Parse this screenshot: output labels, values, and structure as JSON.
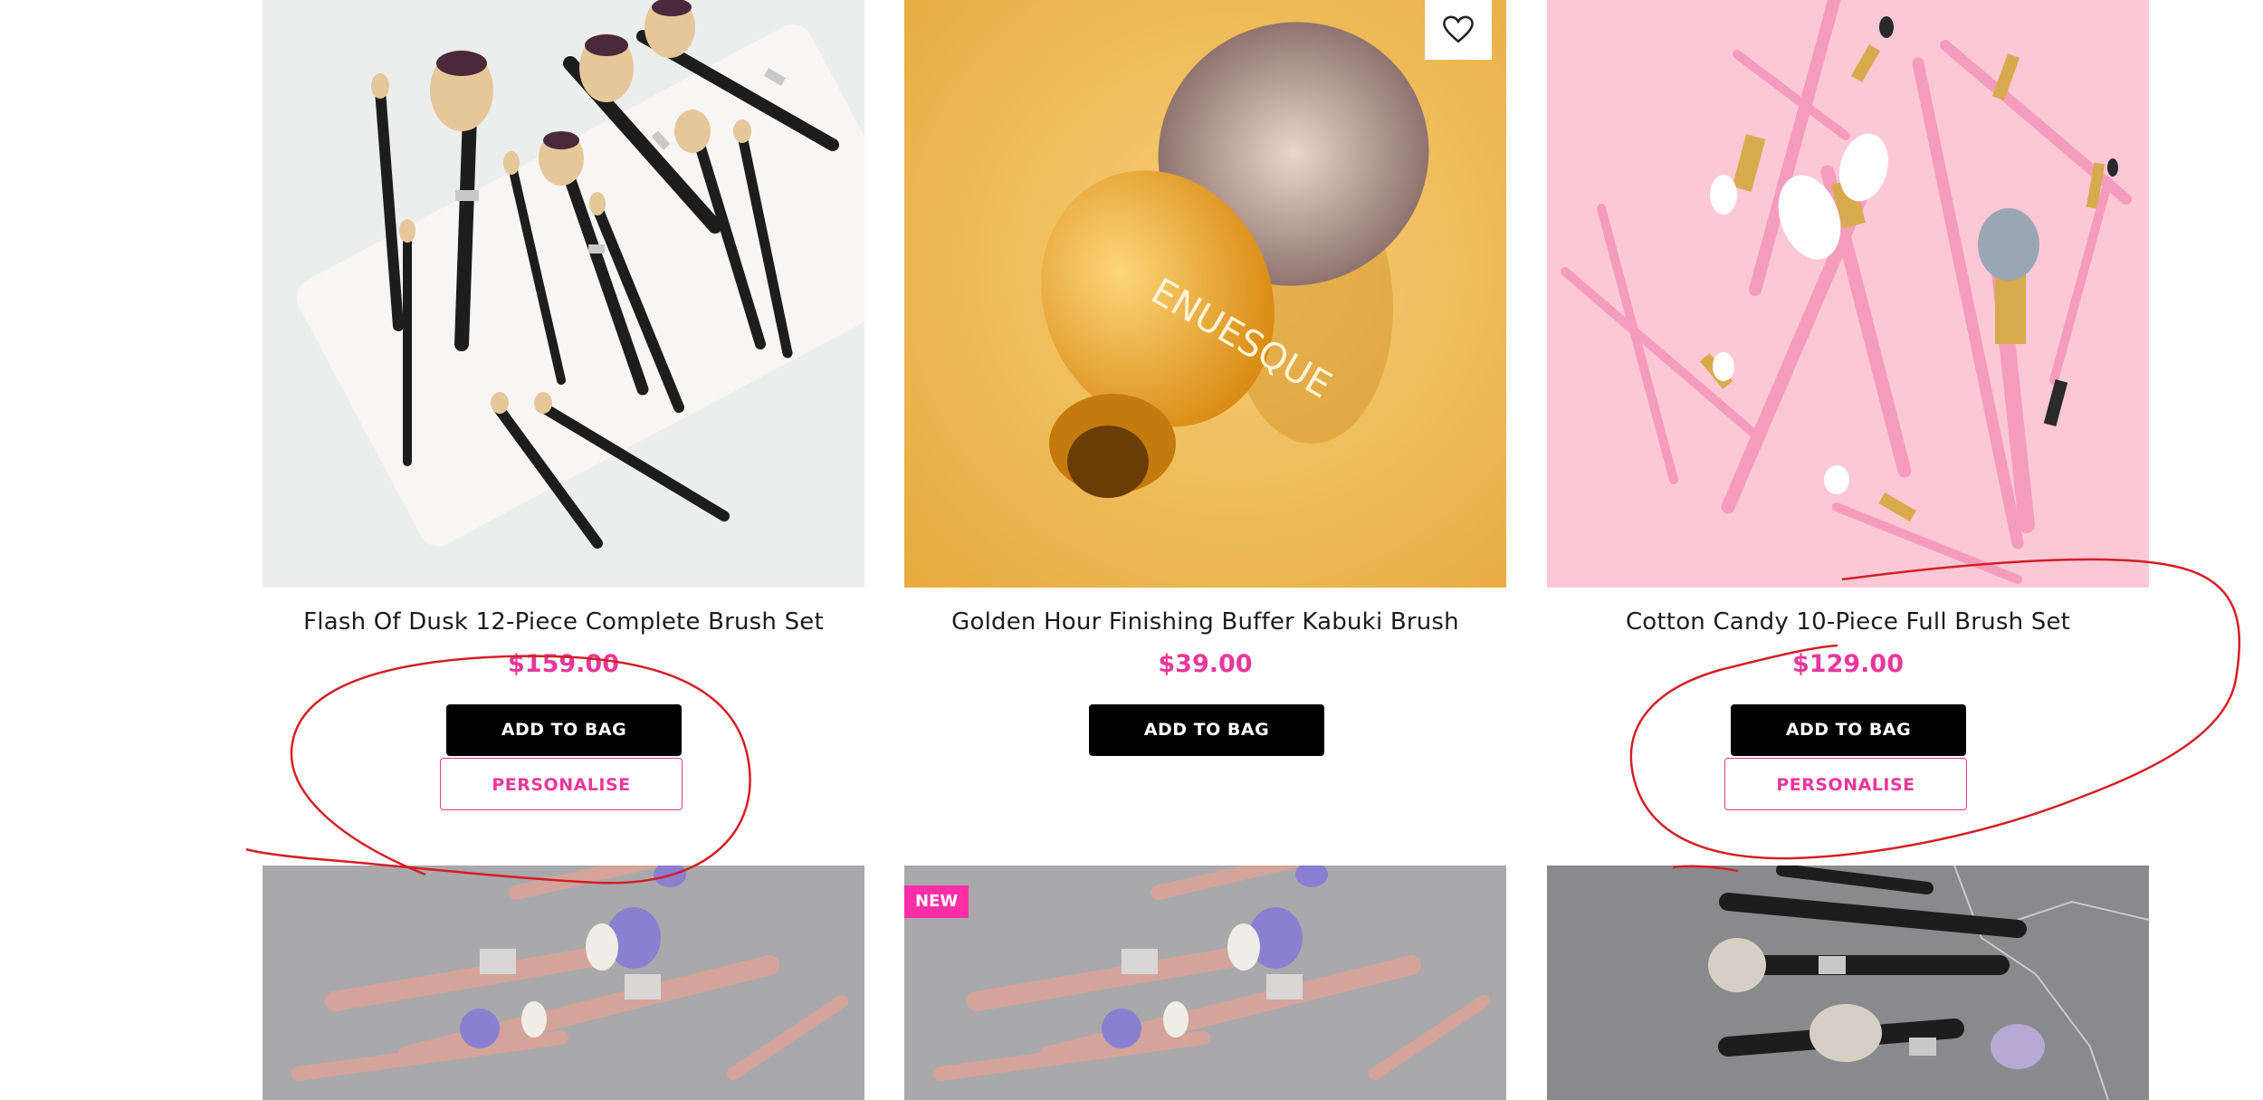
{
  "products": [
    {
      "title": "Flash Of Dusk 12-Piece Complete Brush Set",
      "price": "$159.00",
      "add_label": "ADD TO BAG",
      "personalise_label": "PERSONALISE"
    },
    {
      "title": "Golden Hour Finishing Buffer Kabuki Brush",
      "price": "$39.00",
      "add_label": "ADD TO BAG"
    },
    {
      "title": "Cotton Candy 10-Piece Full Brush Set",
      "price": "$129.00",
      "add_label": "ADD TO BAG",
      "personalise_label": "PERSONALISE"
    }
  ],
  "row2": [
    {
      "badge": ""
    },
    {
      "badge": "NEW"
    },
    {
      "badge": ""
    }
  ],
  "icons": {
    "wishlist": "heart-outline-icon"
  },
  "colors": {
    "accent": "#e8389a",
    "badge": "#ff2ea6",
    "button": "#000000",
    "annotation": "#d41f26"
  }
}
